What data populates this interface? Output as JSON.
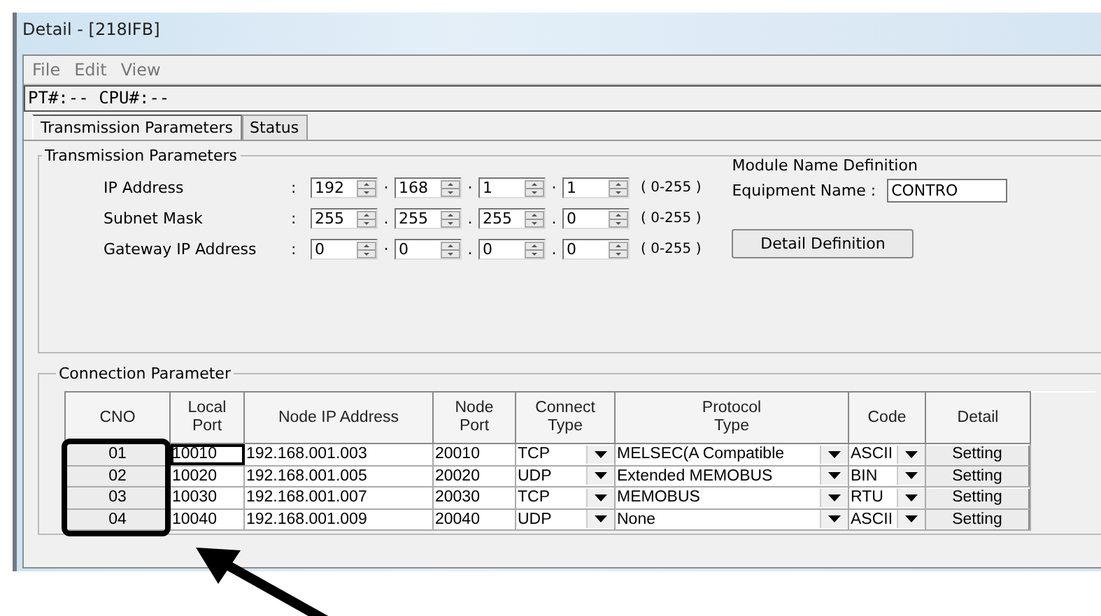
{
  "window": {
    "title": "Detail - [218IFB]"
  },
  "menu": [
    "File",
    "Edit",
    "View"
  ],
  "status_line": "PT#:-- CPU#:--",
  "tabs": [
    {
      "label": "Transmission Parameters",
      "selected": true
    },
    {
      "label": "Status",
      "selected": false
    }
  ],
  "transmission": {
    "title": "Transmission Parameters",
    "rows": [
      {
        "label": "IP Address",
        "colon": ":",
        "octets": [
          "192",
          "168",
          "1",
          "1"
        ],
        "separators": [
          "·",
          "·",
          "·"
        ],
        "range": "( 0-255 )"
      },
      {
        "label": "Subnet Mask",
        "colon": ":",
        "octets": [
          "255",
          "255",
          "255",
          "0"
        ],
        "separators": [
          ".",
          ".",
          "."
        ],
        "range": "( 0-255 )"
      },
      {
        "label": "Gateway IP Address",
        "colon": ":",
        "octets": [
          "0",
          "0",
          "0",
          "0"
        ],
        "separators": [
          "·",
          ".",
          "."
        ],
        "range": "( 0-255 )"
      }
    ],
    "module_title": "Module Name Definition",
    "equipment_label": "Equipment  Name  :",
    "equipment_value": "CONTRO",
    "detail_button": "Detail Definition"
  },
  "connection": {
    "title": "Connection Parameter",
    "columns": [
      "CNO",
      "Local\nPort",
      "Node IP Address",
      "Node\nPort",
      "Connect\nType",
      "Protocol\nType",
      "Code",
      "Detail"
    ],
    "rows": [
      {
        "cno": "01",
        "local_port": "10010",
        "node_ip": "192.168.001.003",
        "node_port": "20010",
        "connect_type": "TCP",
        "protocol": "MELSEC(A Compatible",
        "code": "ASCII",
        "detail": "Setting",
        "focused": true
      },
      {
        "cno": "02",
        "local_port": "10020",
        "node_ip": "192.168.001.005",
        "node_port": "20020",
        "connect_type": "UDP",
        "protocol": "Extended MEMOBUS",
        "code": "BIN",
        "detail": "Setting",
        "focused": false
      },
      {
        "cno": "03",
        "local_port": "10030",
        "node_ip": "192.168.001.007",
        "node_port": "20030",
        "connect_type": "TCP",
        "protocol": "MEMOBUS",
        "code": "RTU",
        "detail": "Setting",
        "focused": false
      },
      {
        "cno": "04",
        "local_port": "10040",
        "node_ip": "192.168.001.009",
        "node_port": "20040",
        "connect_type": "UDP",
        "protocol": "None",
        "code": "ASCII",
        "detail": "Setting",
        "focused": false
      }
    ]
  }
}
